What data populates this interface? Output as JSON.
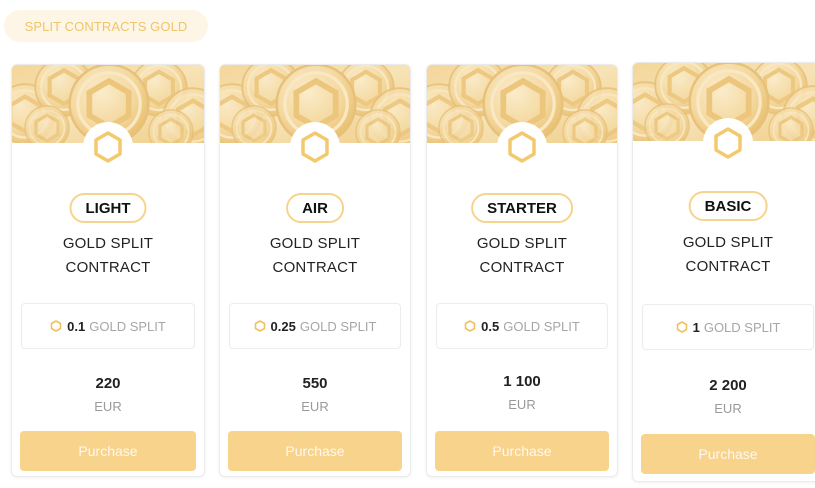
{
  "section": {
    "title": "SPLIT CONTRACTS GOLD"
  },
  "colors": {
    "accent": "#f8d38c",
    "badge_border": "#f6d48c",
    "coin_light": "#f6dca0",
    "coin_dark": "#e6b75c",
    "pill_text": "#f0c46a",
    "muted_text": "#a6a6a6"
  },
  "cards": [
    {
      "tier": "LIGHT",
      "title_line1": "GOLD SPLIT",
      "title_line2": "CONTRACT",
      "amount": "0.1",
      "unit": "GOLD SPLIT",
      "price": "220",
      "currency": "EUR",
      "button": "Purchase",
      "icon": "gold-hexagon-icon"
    },
    {
      "tier": "AIR",
      "title_line1": "GOLD SPLIT",
      "title_line2": "CONTRACT",
      "amount": "0.25",
      "unit": "GOLD SPLIT",
      "price": "550",
      "currency": "EUR",
      "button": "Purchase",
      "icon": "gold-hexagon-icon"
    },
    {
      "tier": "STARTER",
      "title_line1": "GOLD SPLIT",
      "title_line2": "CONTRACT",
      "amount": "0.5",
      "unit": "GOLD SPLIT",
      "price": "1 100",
      "currency": "EUR",
      "button": "Purchase",
      "icon": "gold-hexagon-icon"
    },
    {
      "tier": "BASIC",
      "title_line1": "GOLD SPLIT",
      "title_line2": "CONTRACT",
      "amount": "1",
      "unit": "GOLD SPLIT",
      "price": "2 200",
      "currency": "EUR",
      "button": "Purchase",
      "icon": "gold-hexagon-icon"
    }
  ]
}
